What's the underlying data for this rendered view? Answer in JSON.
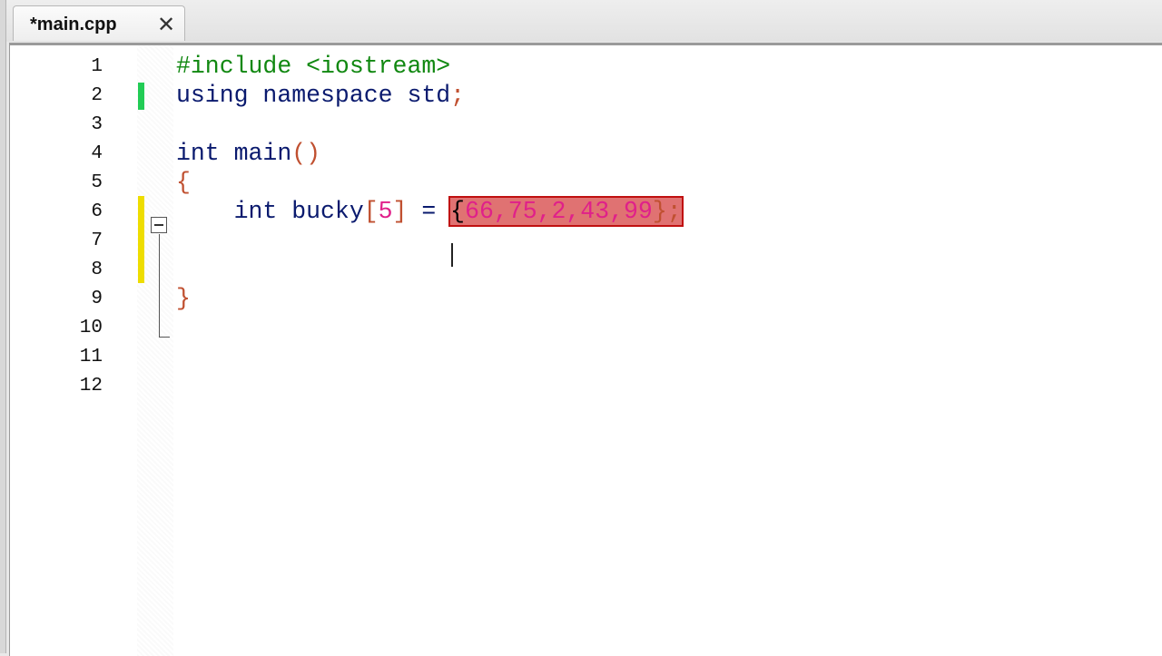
{
  "tab": {
    "label": "*main.cpp",
    "close": "✕"
  },
  "colors": {
    "modified_saved": "#22cc55",
    "modified_unsaved": "#eedd00",
    "selection": "#e07272"
  },
  "lines": [
    {
      "n": "1",
      "tokens": [
        {
          "t": "#include <iostream>",
          "c": "pp"
        }
      ]
    },
    {
      "n": "2",
      "mark": "saved",
      "tokens": [
        {
          "t": "using namespace std",
          "c": "kw"
        },
        {
          "t": ";",
          "c": "br"
        }
      ]
    },
    {
      "n": "3",
      "tokens": []
    },
    {
      "n": "4",
      "tokens": [
        {
          "t": "int main",
          "c": "kw"
        },
        {
          "t": "()",
          "c": "br"
        }
      ]
    },
    {
      "n": "5",
      "tokens": [
        {
          "t": "{",
          "c": "br"
        }
      ]
    },
    {
      "n": "6",
      "mark": "unsaved",
      "tokens": [
        {
          "t": "    int bucky",
          "c": "kw"
        },
        {
          "t": "[",
          "c": "br"
        },
        {
          "t": "5",
          "c": "num"
        },
        {
          "t": "]",
          "c": "br"
        },
        {
          "t": " = ",
          "c": "kw"
        },
        {
          "t": "{",
          "c": "ch",
          "sel": true
        },
        {
          "t": "66,75,2,43,99",
          "c": "num",
          "sel": true
        },
        {
          "t": "};",
          "c": "br",
          "sel": true
        }
      ]
    },
    {
      "n": "7",
      "mark": "unsaved",
      "tokens": []
    },
    {
      "n": "8",
      "mark": "unsaved",
      "tokens": []
    },
    {
      "n": "9",
      "tokens": [
        {
          "t": "}",
          "c": "br"
        }
      ]
    },
    {
      "n": "10",
      "tokens": []
    },
    {
      "n": "11",
      "tokens": []
    },
    {
      "n": "12",
      "tokens": []
    }
  ]
}
